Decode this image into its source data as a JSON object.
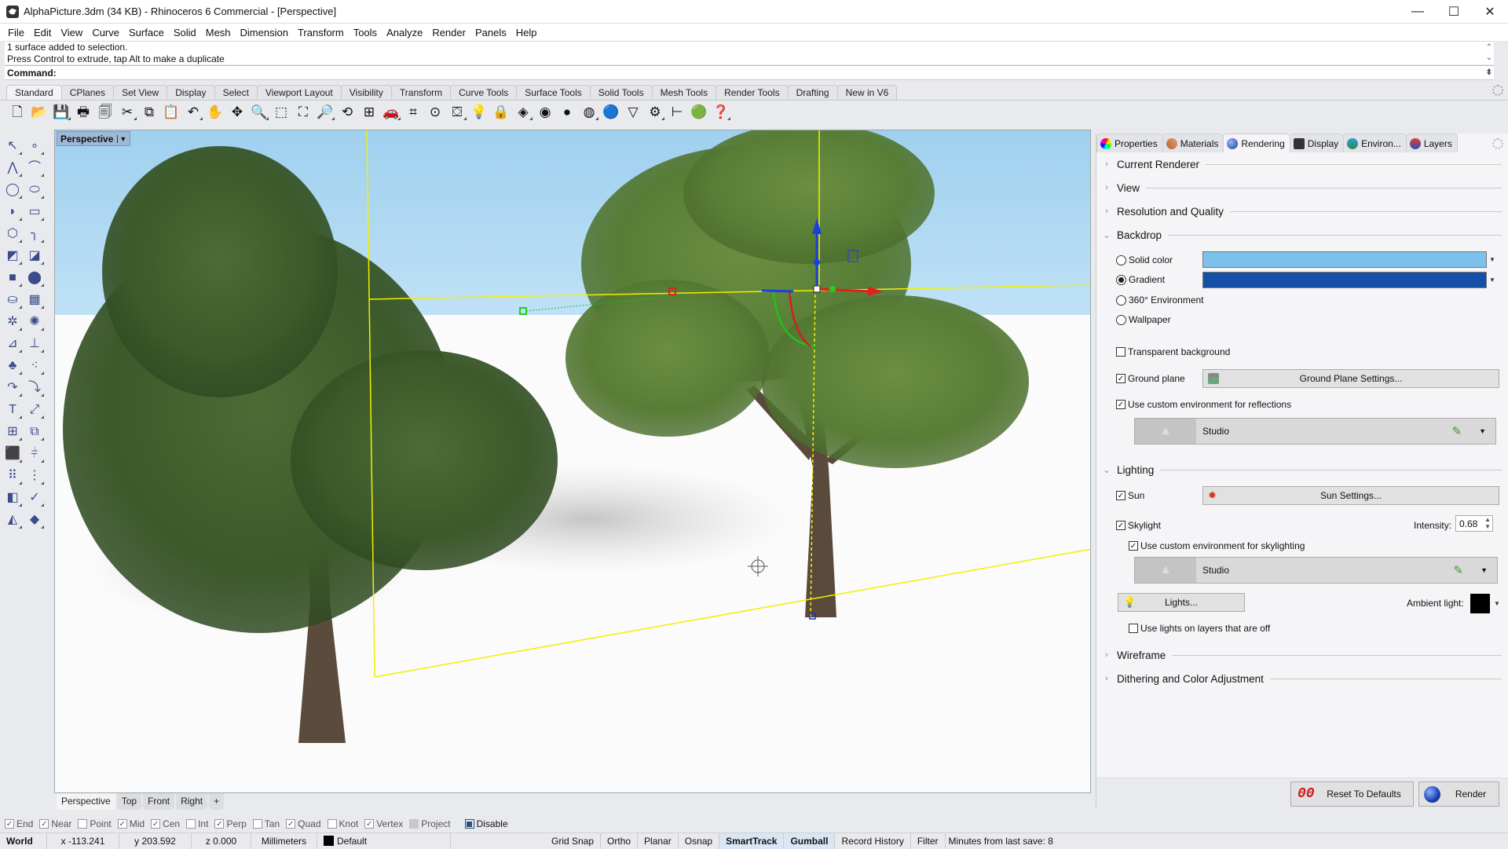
{
  "window": {
    "title": "AlphaPicture.3dm (34 KB) - Rhinoceros 6 Commercial - [Perspective]",
    "controls": {
      "minimize": "—",
      "maximize": "☐",
      "close": "✕"
    }
  },
  "menu": [
    "File",
    "Edit",
    "View",
    "Curve",
    "Surface",
    "Solid",
    "Mesh",
    "Dimension",
    "Transform",
    "Tools",
    "Analyze",
    "Render",
    "Panels",
    "Help"
  ],
  "command": {
    "history": [
      "1 surface added to selection.",
      "Press Control to extrude, tap Alt to make a duplicate"
    ],
    "prompt": "Command:",
    "value": ""
  },
  "toolbar_tabs": [
    {
      "label": "Standard",
      "active": true
    },
    {
      "label": "CPlanes"
    },
    {
      "label": "Set View"
    },
    {
      "label": "Display"
    },
    {
      "label": "Select"
    },
    {
      "label": "Viewport Layout"
    },
    {
      "label": "Visibility"
    },
    {
      "label": "Transform"
    },
    {
      "label": "Curve Tools"
    },
    {
      "label": "Surface Tools"
    },
    {
      "label": "Solid Tools"
    },
    {
      "label": "Mesh Tools"
    },
    {
      "label": "Render Tools"
    },
    {
      "label": "Drafting"
    },
    {
      "label": "New in V6"
    }
  ],
  "toolbar_icons": [
    {
      "name": "new-file-icon",
      "glyph": "🗋"
    },
    {
      "name": "open-folder-icon",
      "glyph": "📂"
    },
    {
      "name": "save-icon",
      "glyph": "💾"
    },
    {
      "name": "print-icon",
      "glyph": "🖶"
    },
    {
      "name": "import-icon",
      "glyph": "🗐"
    },
    {
      "name": "cut-icon",
      "glyph": "✂"
    },
    {
      "name": "copy-icon",
      "glyph": "⧉"
    },
    {
      "name": "paste-icon",
      "glyph": "📋"
    },
    {
      "name": "undo-icon",
      "glyph": "↶"
    },
    {
      "name": "pan-hand-icon",
      "glyph": "✋"
    },
    {
      "name": "rotate-view-icon",
      "glyph": "✥"
    },
    {
      "name": "zoom-in-icon",
      "glyph": "🔍"
    },
    {
      "name": "zoom-window-icon",
      "glyph": "⬚"
    },
    {
      "name": "zoom-extents-icon",
      "glyph": "⛶"
    },
    {
      "name": "zoom-selected-icon",
      "glyph": "🔎"
    },
    {
      "name": "undo-view-icon",
      "glyph": "⟲"
    },
    {
      "name": "four-viewports-icon",
      "glyph": "⊞"
    },
    {
      "name": "shaded-car-icon",
      "glyph": "🚗"
    },
    {
      "name": "cplane-icon",
      "glyph": "⌗"
    },
    {
      "name": "point-on-icon",
      "glyph": "⊙"
    },
    {
      "name": "select-points-icon",
      "glyph": "⛋"
    },
    {
      "name": "light-bulb-icon",
      "glyph": "💡"
    },
    {
      "name": "lock-icon",
      "glyph": "🔒"
    },
    {
      "name": "layers-icon",
      "glyph": "◈"
    },
    {
      "name": "color-wheel-icon",
      "glyph": "◉"
    },
    {
      "name": "sphere-shaded-icon",
      "glyph": "●"
    },
    {
      "name": "sphere-rendered-icon",
      "glyph": "◍"
    },
    {
      "name": "render-icon",
      "glyph": "🔵"
    },
    {
      "name": "cone-icon",
      "glyph": "▽"
    },
    {
      "name": "options-gear-icon",
      "glyph": "⚙"
    },
    {
      "name": "dimension-icon",
      "glyph": "⊢"
    },
    {
      "name": "grasshopper-icon",
      "glyph": "🟢"
    },
    {
      "name": "help-icon",
      "glyph": "❓"
    }
  ],
  "left_tools": [
    {
      "name": "select-arrow-icon",
      "glyph": "↖"
    },
    {
      "name": "point-icon",
      "glyph": "∘"
    },
    {
      "name": "polyline-icon",
      "glyph": "⋀"
    },
    {
      "name": "curve-icon",
      "glyph": "⌒"
    },
    {
      "name": "circle-icon",
      "glyph": "◯"
    },
    {
      "name": "ellipse-icon",
      "glyph": "⬭"
    },
    {
      "name": "arc-icon",
      "glyph": "◗"
    },
    {
      "name": "rectangle-icon",
      "glyph": "▭"
    },
    {
      "name": "polygon-icon",
      "glyph": "⬡"
    },
    {
      "name": "fillet-curve-icon",
      "glyph": "╮"
    },
    {
      "name": "surface-from-points-icon",
      "glyph": "◩"
    },
    {
      "name": "extrude-surface-icon",
      "glyph": "◪"
    },
    {
      "name": "box-icon",
      "glyph": "■"
    },
    {
      "name": "boolean-union-icon",
      "glyph": "⬤"
    },
    {
      "name": "cylinder-icon",
      "glyph": "⛀"
    },
    {
      "name": "mesh-icon",
      "glyph": "▦"
    },
    {
      "name": "puzzle-icon",
      "glyph": "✲"
    },
    {
      "name": "explode-icon",
      "glyph": "✺"
    },
    {
      "name": "trim-icon",
      "glyph": "⊿"
    },
    {
      "name": "split-icon",
      "glyph": "⊥"
    },
    {
      "name": "group-icon",
      "glyph": "♣"
    },
    {
      "name": "ungroup-icon",
      "glyph": "⁖"
    },
    {
      "name": "fillet-edge-icon",
      "glyph": "↷"
    },
    {
      "name": "offset-curve-icon",
      "glyph": "⤵"
    },
    {
      "name": "text-icon",
      "glyph": "T"
    },
    {
      "name": "move-icon",
      "glyph": "⤢"
    },
    {
      "name": "array-icon",
      "glyph": "⊞"
    },
    {
      "name": "orient-icon",
      "glyph": "⧉"
    },
    {
      "name": "solid-edit-icon",
      "glyph": "⬛"
    },
    {
      "name": "dimension-tool-icon",
      "glyph": "⫩"
    },
    {
      "name": "grid-array-icon",
      "glyph": "⠿"
    },
    {
      "name": "history-icon",
      "glyph": "⋮"
    },
    {
      "name": "analyze-icon",
      "glyph": "◧"
    },
    {
      "name": "check-icon",
      "glyph": "✓"
    },
    {
      "name": "render-mesh-icon",
      "glyph": "◭"
    },
    {
      "name": "material-icon",
      "glyph": "◆"
    }
  ],
  "viewport": {
    "label": "Perspective",
    "tabs": [
      {
        "label": "Perspective",
        "active": true
      },
      {
        "label": "Top"
      },
      {
        "label": "Front"
      },
      {
        "label": "Right"
      }
    ],
    "add_tab": "+"
  },
  "osnaps": [
    {
      "label": "End",
      "checked": true
    },
    {
      "label": "Near",
      "checked": true
    },
    {
      "label": "Point",
      "checked": false
    },
    {
      "label": "Mid",
      "checked": true
    },
    {
      "label": "Cen",
      "checked": true
    },
    {
      "label": "Int",
      "checked": false
    },
    {
      "label": "Perp",
      "checked": true
    },
    {
      "label": "Tan",
      "checked": false
    },
    {
      "label": "Quad",
      "checked": true
    },
    {
      "label": "Knot",
      "checked": false
    },
    {
      "label": "Vertex",
      "checked": true
    },
    {
      "label": "Project",
      "checked": false
    },
    {
      "label": "Disable",
      "checked": false
    }
  ],
  "status": {
    "cplane": "World",
    "x": "x -113.241",
    "y": "y 203.592",
    "z": "z 0.000",
    "units": "Millimeters",
    "layer": "Default",
    "layer_color": "#000000",
    "toggles": [
      {
        "label": "Grid Snap",
        "on": false
      },
      {
        "label": "Ortho",
        "on": false
      },
      {
        "label": "Planar",
        "on": false
      },
      {
        "label": "Osnap",
        "on": false
      },
      {
        "label": "SmartTrack",
        "on": true
      },
      {
        "label": "Gumball",
        "on": true
      },
      {
        "label": "Record History",
        "on": false
      },
      {
        "label": "Filter",
        "on": false
      }
    ],
    "save_info": "Minutes from last save: 8"
  },
  "panel": {
    "tabs": [
      {
        "label": "Properties",
        "icon": "color-wheel"
      },
      {
        "label": "Materials",
        "icon": "brush"
      },
      {
        "label": "Rendering",
        "icon": "teapot",
        "active": true
      },
      {
        "label": "Display",
        "icon": "monitor"
      },
      {
        "label": "Environ...",
        "icon": "dome"
      },
      {
        "label": "Layers",
        "icon": "layers"
      }
    ],
    "sections": {
      "current_renderer": "Current Renderer",
      "view": "View",
      "resolution": "Resolution and Quality",
      "backdrop": "Backdrop",
      "lighting": "Lighting",
      "wireframe": "Wireframe",
      "dithering": "Dithering and Color Adjustment"
    },
    "backdrop": {
      "options": [
        {
          "label": "Solid color",
          "selected": false
        },
        {
          "label": "Gradient",
          "selected": true
        },
        {
          "label": "360° Environment",
          "selected": false
        },
        {
          "label": "Wallpaper",
          "selected": false
        }
      ],
      "solid_color": "#7cc0ec",
      "gradient_color": "#1450a8",
      "transparent_background": {
        "label": "Transparent background",
        "checked": false
      },
      "ground_plane": {
        "label": "Ground plane",
        "checked": true
      },
      "ground_plane_button": "Ground Plane Settings...",
      "custom_env_reflections": {
        "label": "Use custom environment for reflections",
        "checked": true
      },
      "reflection_env": "Studio"
    },
    "lighting": {
      "sun": {
        "label": "Sun",
        "checked": true
      },
      "sun_button": "Sun Settings...",
      "skylight": {
        "label": "Skylight",
        "checked": true
      },
      "intensity_label": "Intensity:",
      "intensity": "0.68",
      "custom_env_skylight": {
        "label": "Use custom environment for skylighting",
        "checked": true
      },
      "skylight_env": "Studio",
      "lights_button": "Lights...",
      "ambient_label": "Ambient light:",
      "ambient_color": "#000000",
      "lights_on_off_layers": {
        "label": "Use lights on layers that are off",
        "checked": false
      }
    },
    "footer": {
      "reset": "Reset To Defaults",
      "render": "Render"
    }
  }
}
